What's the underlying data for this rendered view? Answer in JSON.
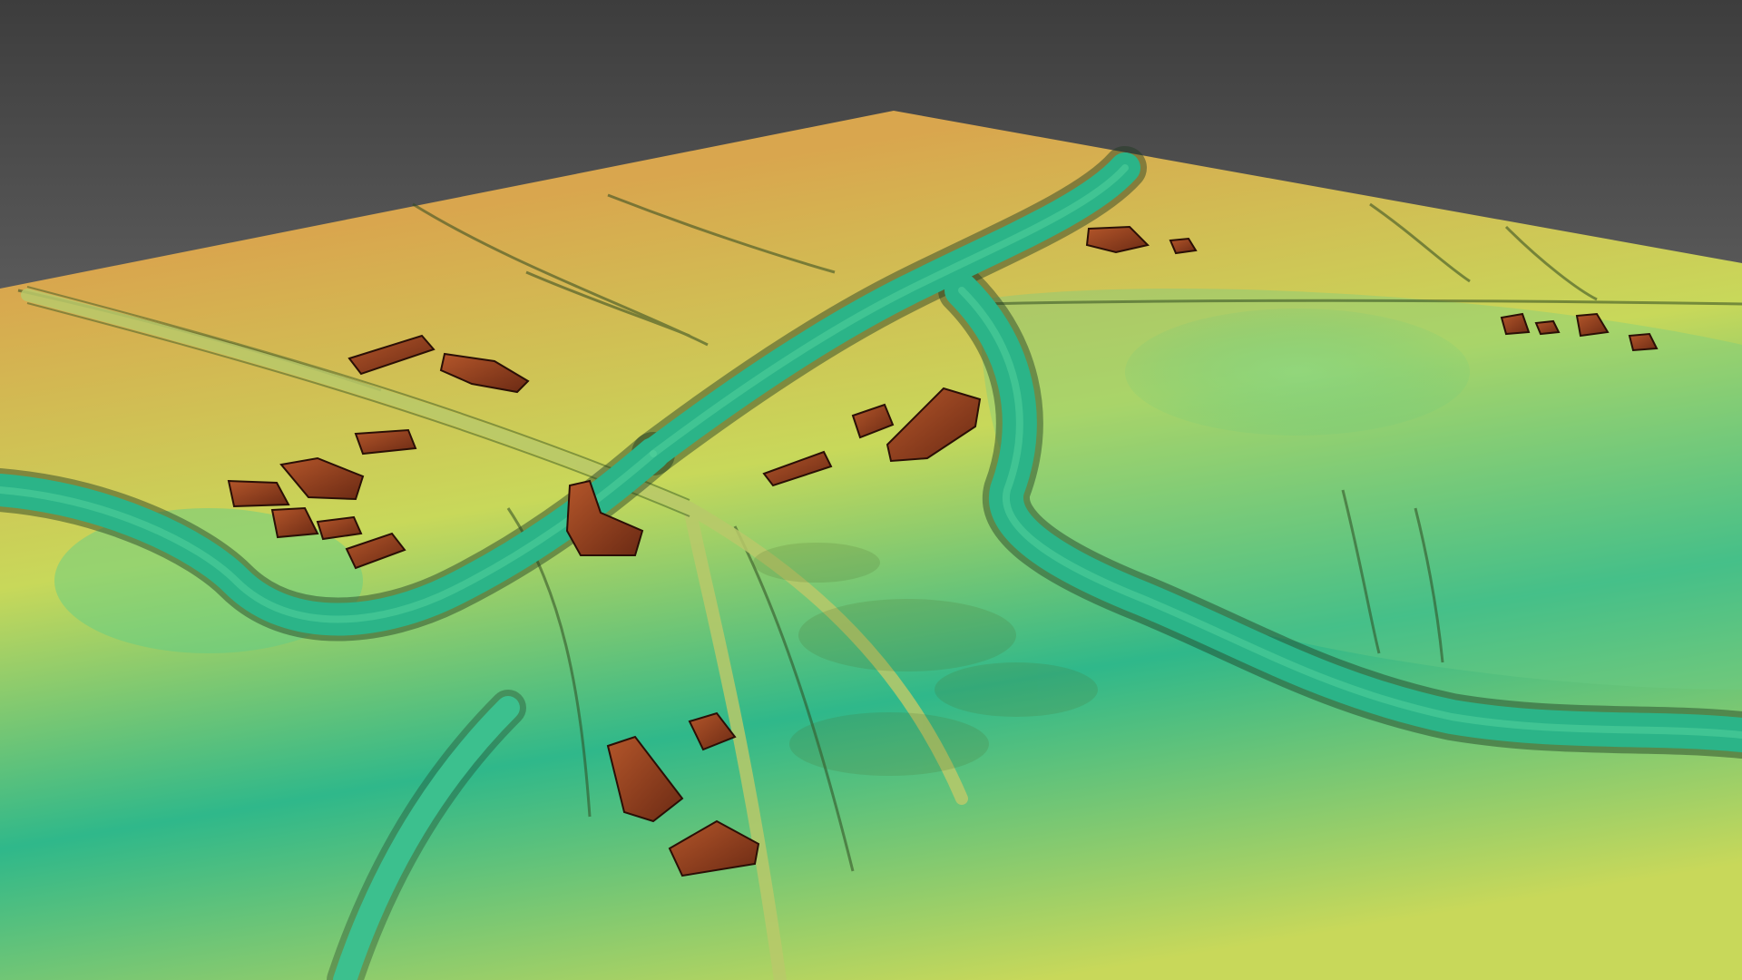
{
  "scene": {
    "type": "lidar-elevation-terrain-3d",
    "colors": {
      "sky_top": "#3d3d3d",
      "sky_bottom": "#9e9e9e",
      "elevation_high": "#d9a64e",
      "elevation_mid": "#c8d85a",
      "elevation_low": "#2fb88a",
      "channel": "#22a97f",
      "building": "#6b2a14",
      "building_light": "#b4562a",
      "shadow": "#1f3a22"
    }
  }
}
